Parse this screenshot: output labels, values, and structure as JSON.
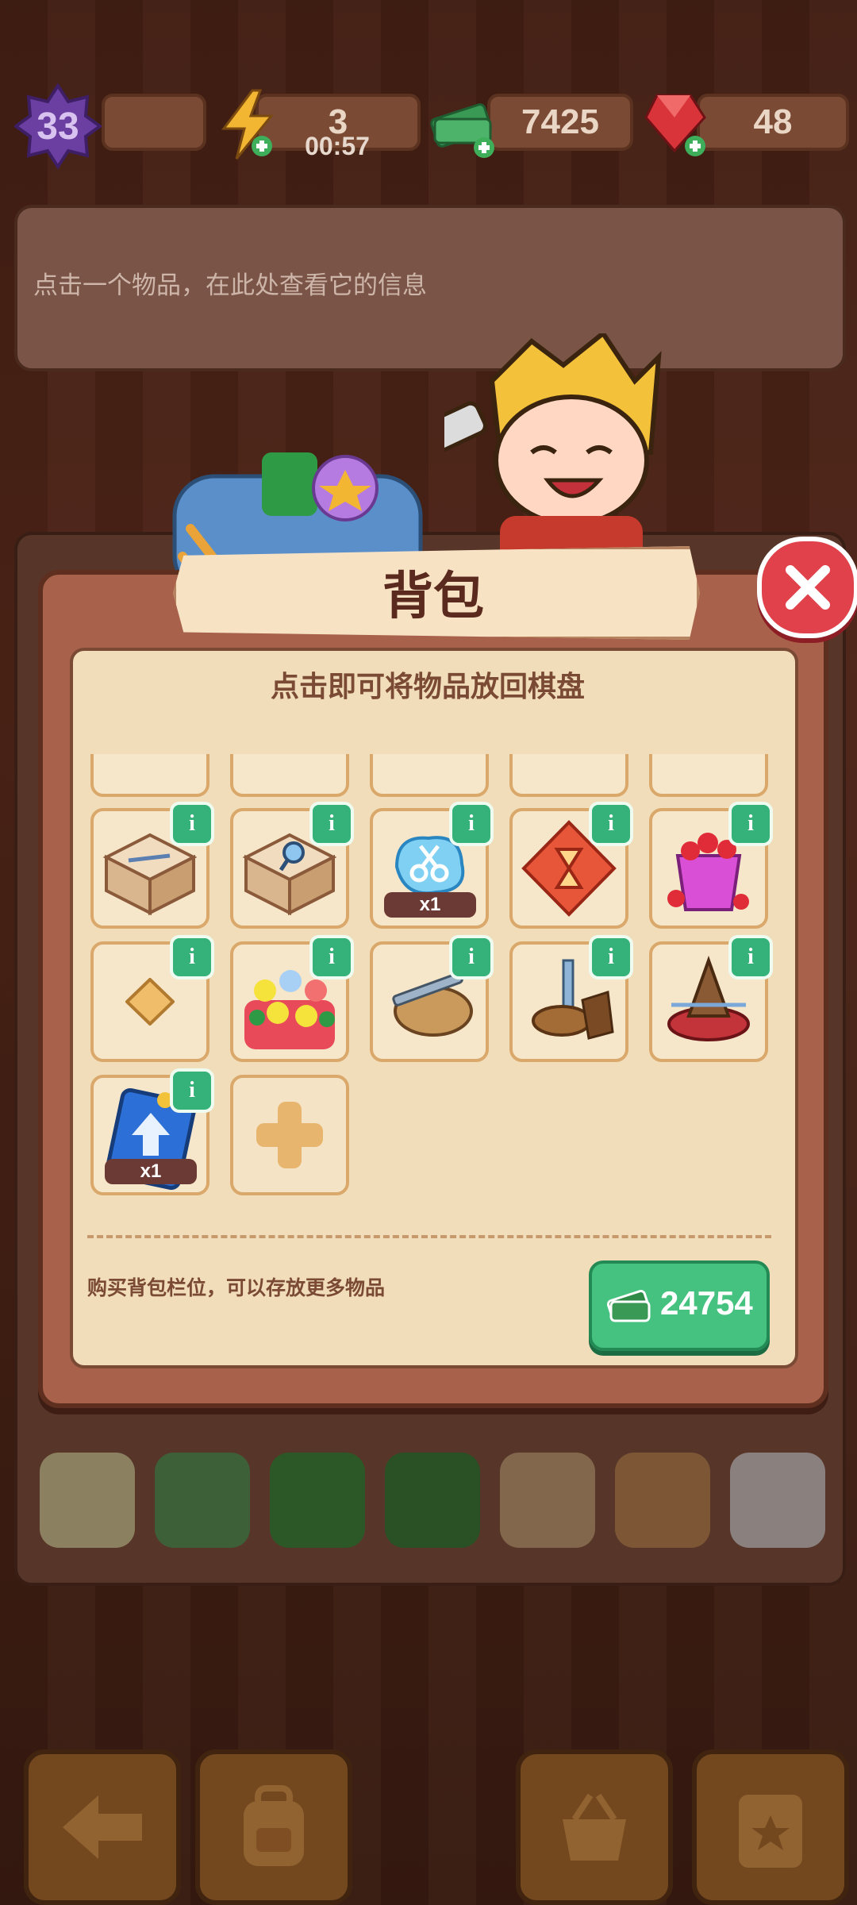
{
  "hud": {
    "level": "33",
    "energy": "3",
    "energy_timer": "00:57",
    "cash": "7425",
    "gems": "48"
  },
  "info_panel": {
    "hint": "点击一个物品，在此处查看它的信息"
  },
  "backpack_modal": {
    "title": "背包",
    "subtitle": "点击即可将物品放回棋盘",
    "items": [
      {
        "name": "scissors-tape-box",
        "info": "i"
      },
      {
        "name": "magnifier-box",
        "info": "i"
      },
      {
        "name": "scissors-bubble",
        "info": "i",
        "quantity": "x1"
      },
      {
        "name": "hourglass-gem",
        "info": "i"
      },
      {
        "name": "ruby-bucket",
        "info": "i"
      },
      {
        "name": "cracker",
        "info": "i"
      },
      {
        "name": "flower-basket",
        "info": "i"
      },
      {
        "name": "wood-slice-tool",
        "info": "i"
      },
      {
        "name": "stump-post",
        "info": "i"
      },
      {
        "name": "spinning-top-stand",
        "info": "i"
      },
      {
        "name": "upgrade-card",
        "info": "i",
        "quantity": "x1"
      }
    ],
    "buy_slot_text": "购买背包栏位，可以存放更多物品",
    "buy_price": "24754"
  },
  "colors": {
    "accent_green": "#45c27f",
    "close_red": "#e0414b",
    "panel_cream": "#f1ddb9",
    "frame_brown": "#a8614a"
  }
}
